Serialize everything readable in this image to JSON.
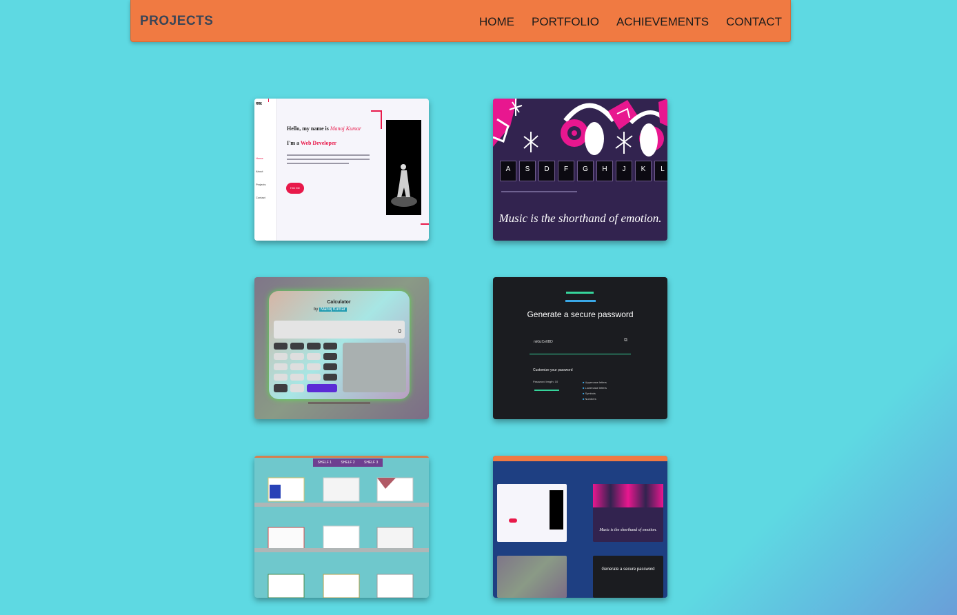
{
  "navbar": {
    "brand": "PROJECTS",
    "links": [
      "HOME",
      "PORTFOLIO",
      "ACHIEVEMENTS",
      "CONTACT"
    ]
  },
  "projects": [
    {
      "name": "portfolio-site",
      "greeting": "Hello, my name is",
      "role_prefix": "I'm a",
      "role": "Web Developer",
      "button": "Hire Me",
      "menu": [
        "Home",
        "About",
        "Projects",
        "Contact"
      ]
    },
    {
      "name": "drum-kit",
      "keys": [
        "A",
        "S",
        "D",
        "F",
        "G",
        "H",
        "J",
        "K",
        "L"
      ],
      "quote": "Music is the shorthand of emotion."
    },
    {
      "name": "calculator",
      "title": "Calculator",
      "by": "by",
      "author": "Manoj Kumar",
      "display_value": "0"
    },
    {
      "name": "password-generator",
      "title": "Generate a secure password",
      "password": "nkGzCe0BD",
      "subtitle": "Customize your password",
      "length_label": "Password length: 10",
      "options": [
        "Uppercase letters",
        "Lowercase letters",
        "Symbols",
        "Numbers"
      ]
    },
    {
      "name": "achievements-shelf",
      "tabs": [
        "SHELF 1",
        "SHELF 2",
        "SHELF 3"
      ]
    },
    {
      "name": "portfolio-preview",
      "quote": "Music is the shorthand of emotion.",
      "password_title": "Generate a secure password"
    }
  ],
  "colors": {
    "background": "#5ed9e2",
    "navbar": "#f07a42",
    "accent_pink": "#e8194a",
    "drum_bg": "#32234f",
    "magenta": "#e8178f"
  }
}
